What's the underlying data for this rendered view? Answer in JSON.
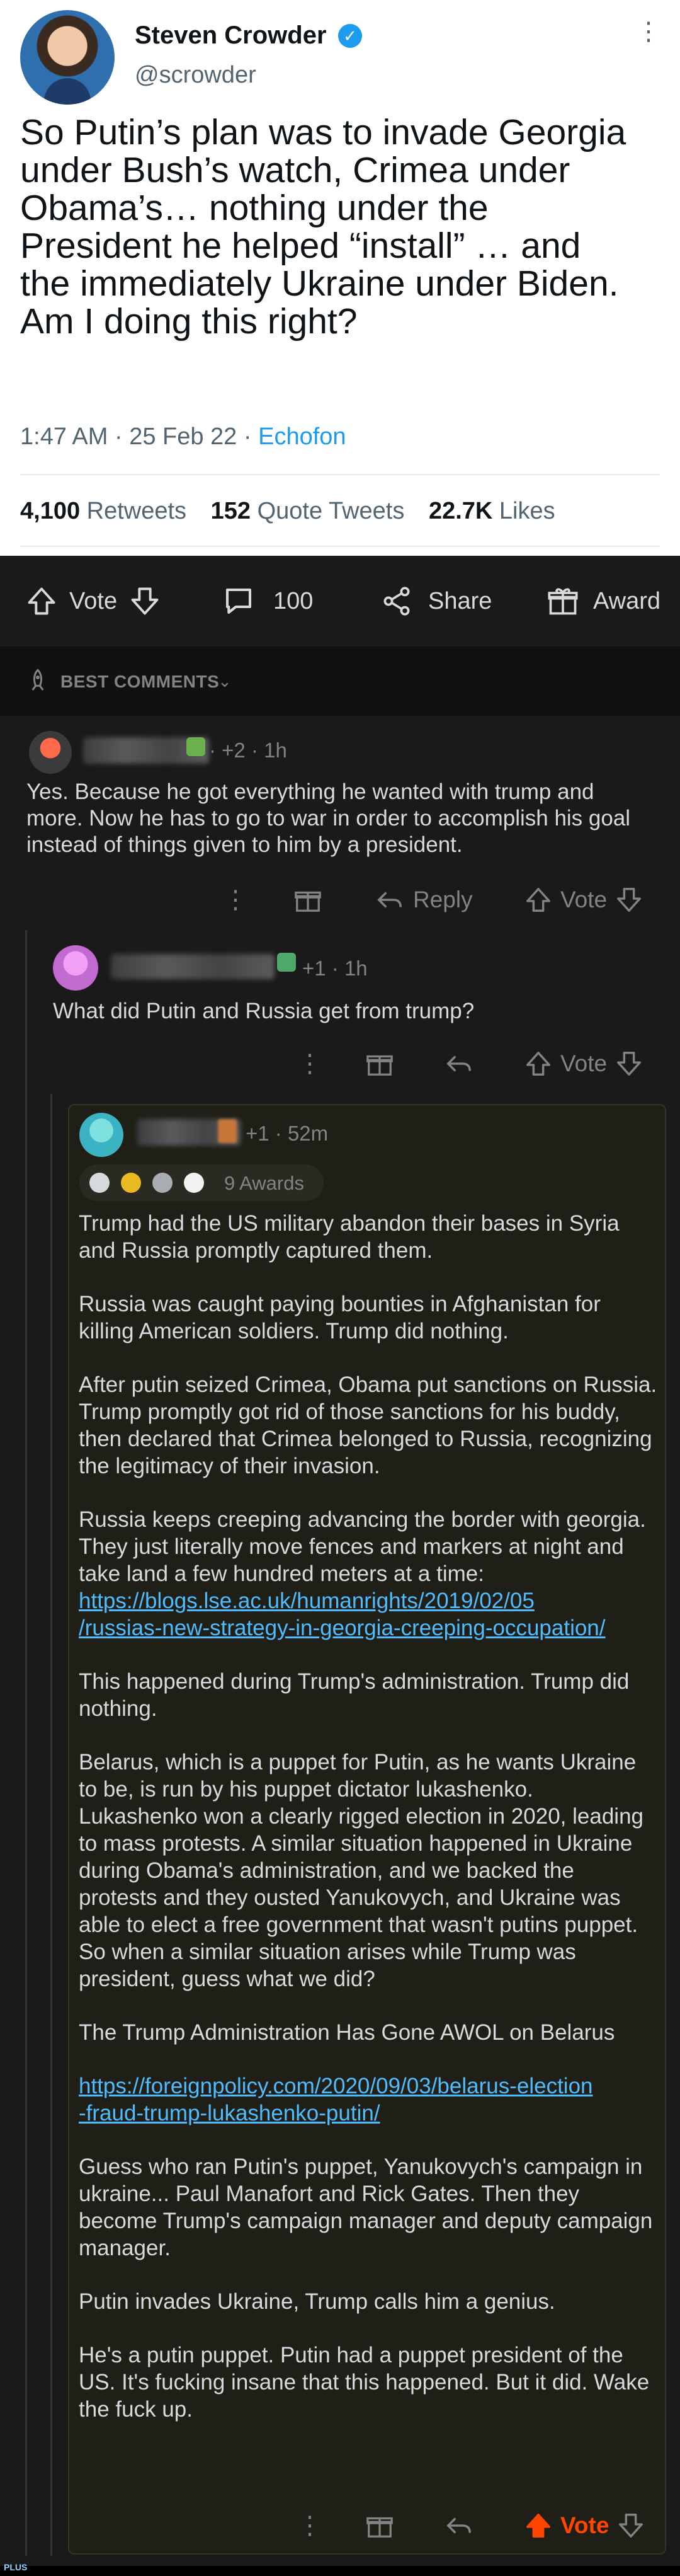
{
  "tweet": {
    "name": "Steven Crowder",
    "handle": "@scrowder",
    "verified_glyph": "✓",
    "more_glyph": "⋮",
    "text": "So Putin’s plan was to invade Georgia\nunder Bush’s watch, Crimea under\nObama’s… nothing under the\nPresident he helped “install” … and\nthe immediately Ukraine under Biden.\nAm I doing this right?",
    "time": "1:47 AM · 25 Feb 22 · ",
    "source": "Echofon",
    "retweets_count": "4,100",
    "retweets_label": "Retweets",
    "quotes_count": "152",
    "quotes_label": "Quote Tweets",
    "likes_count": "22.7K",
    "likes_label": "Likes"
  },
  "post_bar": {
    "vote_label": "Vote",
    "comments_count": "100",
    "share_label": "Share",
    "award_label": "Award"
  },
  "sort": {
    "label": "BEST COMMENTS",
    "chevron": "⌄"
  },
  "comments": [
    {
      "meta": "· +2 · 1h",
      "text": "Yes. Because he got everything he wanted with trump and more. Now he has to go to war in order to accomplish his goal instead of things given to him by a president.",
      "more_glyph": "⋮",
      "reply_label": "Reply",
      "vote_label": "Vote"
    },
    {
      "meta": "+1 · 1h",
      "text": "What did Putin and Russia get from trump?",
      "more_glyph": "⋮",
      "vote_label": "Vote"
    },
    {
      "meta": "+1 · 52m",
      "awards_count": "9 Awards",
      "more_glyph": "⋮",
      "vote_label": "Vote",
      "paragraphs": [
        "Trump had the US military abandon their bases in Syria and Russia promptly captured them.",
        "Russia was caught paying bounties in Afghanistan for killing American soldiers. Trump did nothing.",
        "After putin seized Crimea, Obama put sanctions on Russia. Trump promptly got rid of those sanctions for his buddy, then declared that Crimea belonged to Russia, recognizing the legitimacy of their invasion.",
        "Russia keeps creeping advancing the border with georgia. They just literally move fences and markers at night and take land a few hundred meters at a time:",
        "This happened during Trump's administration. Trump did nothing.",
        "Belarus, which is a puppet for Putin, as he wants Ukraine to be, is run by his puppet dictator lukashenko. Lukashenko won a clearly rigged election in 2020, leading to mass protests. A similar situation happened in Ukraine during Obama's administration, and we backed the protests and they ousted Yanukovych, and Ukraine was able to elect a free government that wasn't putins puppet. So when a similar situation arises while Trump was president,  guess what we did?",
        "The Trump Administration Has Gone AWOL on Belarus",
        "Guess who ran Putin's puppet, Yanukovych's campaign in ukraine... Paul Manafort and Rick Gates. Then they become Trump's campaign manager and deputy campaign manager.",
        "Putin invades Ukraine, Trump calls him a genius.",
        "He's a putin puppet. Putin had a puppet president of the US. It's fucking insane that this happened. But it did. Wake the fuck up."
      ],
      "link1_a": "https://blogs.lse.ac.uk/humanrights/2019/02/05",
      "link1_b": "/russias-new-strategy-in-georgia-creeping-occupation/",
      "link2_a": "https://foreignpolicy.com/2020/09/03/belarus-election",
      "link2_b": "-fraud-trump-lukashenko-putin/"
    }
  ],
  "watermark": "PLUS",
  "colors": {
    "reddit_bg": "#1a1a1b",
    "upvote": "#ff4500",
    "link": "#4fbcff",
    "twitter_blue": "#1d9bf0"
  }
}
